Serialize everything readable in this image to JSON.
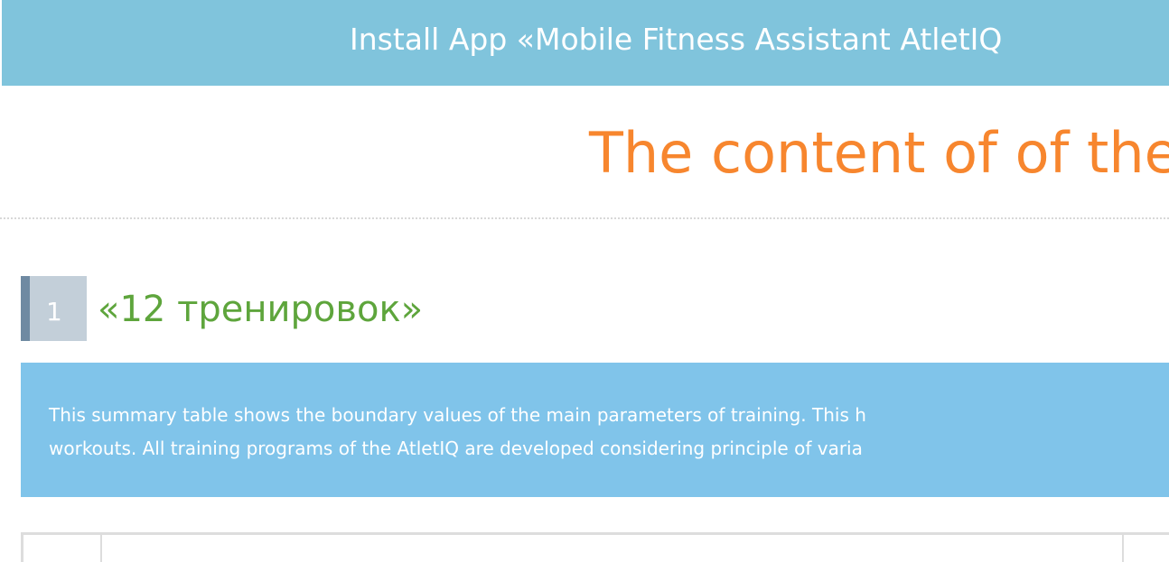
{
  "install_banner": {
    "text": "Install App «Mobile Fitness Assistant AtletIQ"
  },
  "page_title": "The content of of the",
  "section": {
    "number": "1",
    "title": "«12 тренировок»"
  },
  "summary": {
    "line1": "This summary table shows the boundary values of the main parameters of training. This h",
    "line2": "workouts. All training programs of the AtletIQ are developed considering principle of varia"
  },
  "colors": {
    "banner_bg": "#80c4dc",
    "title": "#f7862e",
    "section_title": "#5ea53c",
    "badge_bg": "#c3cfd9",
    "badge_accent": "#6f8aa2",
    "summary_bg": "#80c4ea"
  }
}
